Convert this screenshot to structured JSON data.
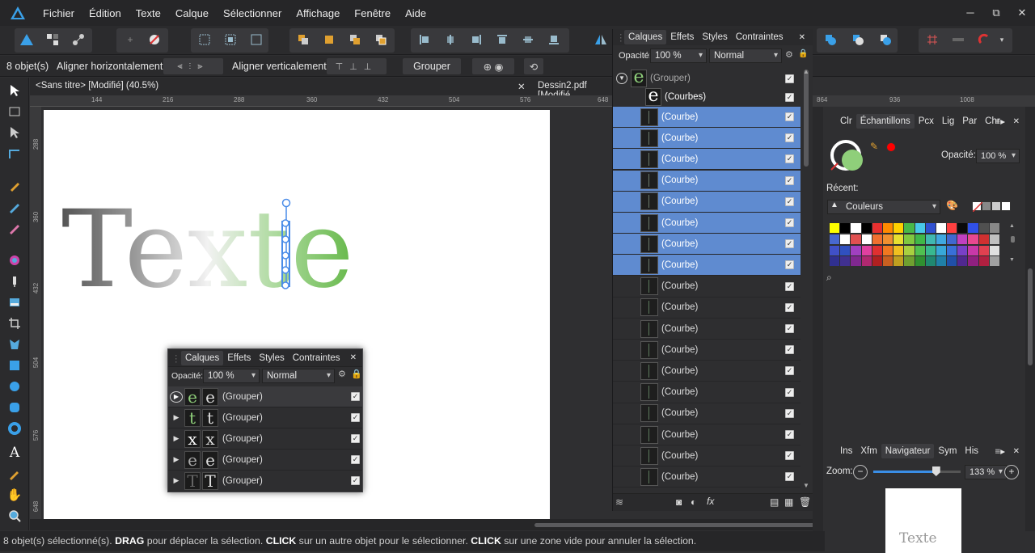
{
  "menu": [
    "Fichier",
    "Édition",
    "Texte",
    "Calque",
    "Sélectionner",
    "Affichage",
    "Fenêtre",
    "Aide"
  ],
  "window": {
    "minimize": "─",
    "restore": "⧉",
    "close": "✕"
  },
  "context": {
    "count": "8 objet(s)",
    "align_h": "Aligner horizontalement:",
    "align_v": "Aligner verticalement:",
    "group_btn": "Grouper"
  },
  "doc": {
    "tab1": "<Sans titre> [Modifié] (40.5%)",
    "tab2": "Dessin2.pdf [Modifié"
  },
  "ruler_h": [
    "144",
    "216",
    "288",
    "360",
    "432",
    "504",
    "576",
    "648"
  ],
  "ruler_h2": [
    "864",
    "936",
    "1008"
  ],
  "ruler_v": [
    "288",
    "360",
    "432",
    "504",
    "576",
    "648"
  ],
  "canvas_text": "Texte",
  "layers": {
    "tabs": [
      "Calques",
      "Effets",
      "Styles",
      "Contraintes"
    ],
    "opacity_label": "Opacité:",
    "opacity": "100 %",
    "blend": "Normal",
    "group_label": "(Grouper)",
    "curves_label": "(Courbes)",
    "item_label": "(Courbe)",
    "items": [
      {
        "selected": true
      },
      {
        "selected": true
      },
      {
        "selected": true
      },
      {
        "selected": true
      },
      {
        "selected": true
      },
      {
        "selected": true
      },
      {
        "selected": true
      },
      {
        "selected": true
      },
      {
        "selected": false
      },
      {
        "selected": false
      },
      {
        "selected": false
      },
      {
        "selected": false
      },
      {
        "selected": false
      },
      {
        "selected": false
      },
      {
        "selected": false
      },
      {
        "selected": false
      },
      {
        "selected": false
      },
      {
        "selected": false
      }
    ]
  },
  "float_layers": {
    "tabs": [
      "Calques",
      "Effets",
      "Styles",
      "Contraintes"
    ],
    "opacity_label": "Opacité:",
    "opacity": "100 %",
    "blend": "Normal",
    "rows": [
      {
        "glyph": "e",
        "label": "(Grouper)"
      },
      {
        "glyph": "t",
        "label": "(Grouper)"
      },
      {
        "glyph": "x",
        "label": "(Grouper)"
      },
      {
        "glyph": "e",
        "label": "(Grouper)"
      },
      {
        "glyph": "T",
        "label": "(Grouper)"
      }
    ]
  },
  "swatches": {
    "tabs": [
      "Clr",
      "Échantillons",
      "Pcx",
      "Lig",
      "Par",
      "Chr"
    ],
    "opacity_label": "Opacité:",
    "opacity": "100 %",
    "recent_label": "Récent:",
    "palette": "Couleurs",
    "fill_color": "#8fcf7a",
    "stroke_color": "#ff0000"
  },
  "navigator": {
    "tabs": [
      "Ins",
      "Xfm",
      "Navigateur",
      "Sym",
      "His"
    ],
    "zoom_label": "Zoom:",
    "zoom": "133 %",
    "preview_text": "Texte",
    "zoom_level": 0.72
  },
  "status": {
    "count": "8 objet(s) sélectionné(s).",
    "k1": "DRAG",
    "t1": " pour déplacer la sélection. ",
    "k2": "CLICK",
    "t2": " sur un autre objet pour le sélectionner. ",
    "k3": "CLICK",
    "t3": " sur une zone vide pour annuler la sélection."
  }
}
